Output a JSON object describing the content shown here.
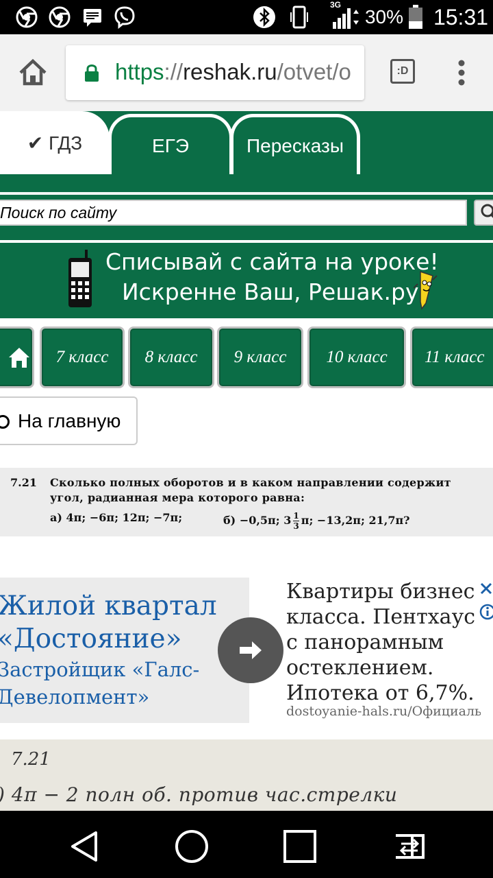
{
  "status_bar": {
    "network": "3G",
    "battery": "30%",
    "time": "15:31"
  },
  "browser": {
    "url_scheme": "https",
    "url_sep": "://",
    "url_host": "reshak.ru",
    "url_path": "/otvet/o",
    "tab_switcher_label": ":D"
  },
  "site": {
    "tabs": [
      {
        "label": "✔ ГДЗ",
        "active": true
      },
      {
        "label": "ЕГЭ",
        "active": false
      },
      {
        "label": "Пересказы",
        "active": false
      }
    ],
    "search_placeholder": "Поиск по сайту",
    "banner_line1": "Списывай с сайта на уроке!",
    "banner_line2": "Искренне Ваш, Решак.ру",
    "classes": [
      "7 класс",
      "8 класс",
      "9 класс",
      "10 класс",
      "11 класс"
    ],
    "home_link": "На главную"
  },
  "problem": {
    "number": "7.21",
    "line1": "Сколько полных оборотов и в каком направлении содержит",
    "line2": "угол, радианная мера которого равна:",
    "part_a": "а)  4π;  −6π;  12π;  −7π;",
    "part_b_prefix": "б)  −0,5π;  3",
    "part_b_frac_num": "1",
    "part_b_frac_den": "3",
    "part_b_suffix": "π;  −13,2π;  21,7π?"
  },
  "ad": {
    "title_line1": "Жилой квартал",
    "title_line2": "«Достояние»",
    "sub_line1": "Застройщик «Галс-",
    "sub_line2": "Девелопмент»",
    "body_lines": [
      "Квартиры бизнес",
      "класса. Пентхаусы",
      "с панорамным",
      "остеклением.",
      "Ипотека от 6,7%."
    ],
    "url": "dostoyanie-hals.ru/Официальный"
  },
  "handwritten": {
    "line1": "7.21",
    "line2": ") 4π − 2 полн об. против час.стрелки"
  },
  "colors": {
    "site_green": "#0b6d46",
    "url_green": "#0b8043",
    "ad_blue": "#1a5fa8"
  }
}
